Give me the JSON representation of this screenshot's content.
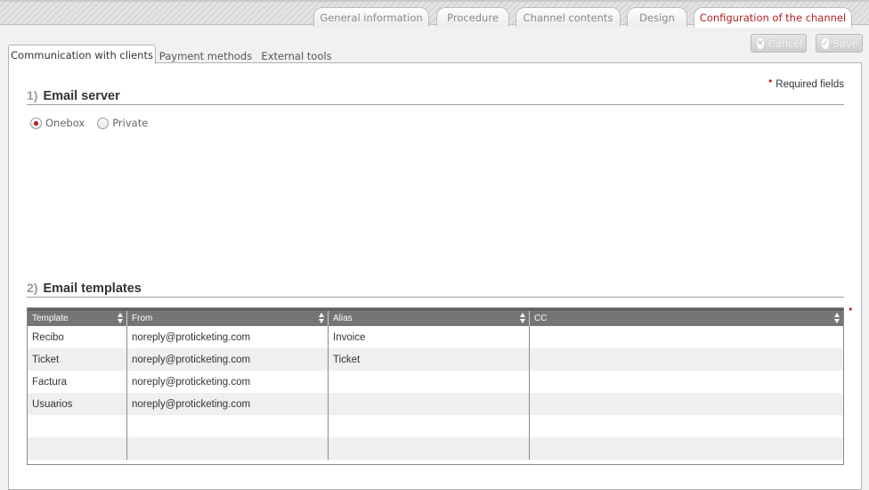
{
  "top_tabs": {
    "general": "General information",
    "procedure": "Procedure",
    "contents": "Channel contents",
    "design": "Design",
    "config": "Configuration of the channel"
  },
  "actions": {
    "cancel": "Cancel",
    "save": "Save"
  },
  "sub_tabs": {
    "communication": "Communication with clients",
    "payment": "Payment methods",
    "external": "External tools"
  },
  "required_note": "Required fields",
  "required_mark": "•",
  "sections": {
    "email_server": {
      "num": "1)",
      "title": "Email server"
    },
    "email_templates": {
      "num": "2)",
      "title": "Email templates"
    }
  },
  "email_server_options": {
    "onebox": "Onebox",
    "private": "Private",
    "selected": "Onebox"
  },
  "grid": {
    "columns": [
      "Template",
      "From",
      "Alias",
      "CC"
    ],
    "rows": [
      [
        "Recibo",
        "noreply@proticketing.com",
        "Invoice",
        ""
      ],
      [
        "Ticket",
        "noreply@proticketing.com",
        "Ticket",
        ""
      ],
      [
        "Factura",
        "noreply@proticketing.com",
        "",
        ""
      ],
      [
        "Usuarios",
        "noreply@proticketing.com",
        "",
        ""
      ],
      [
        "",
        "",
        "",
        ""
      ],
      [
        "",
        "",
        "",
        ""
      ]
    ]
  },
  "colors": {
    "accent": "#b41e1e",
    "header_gray": "#6e6e6e"
  }
}
